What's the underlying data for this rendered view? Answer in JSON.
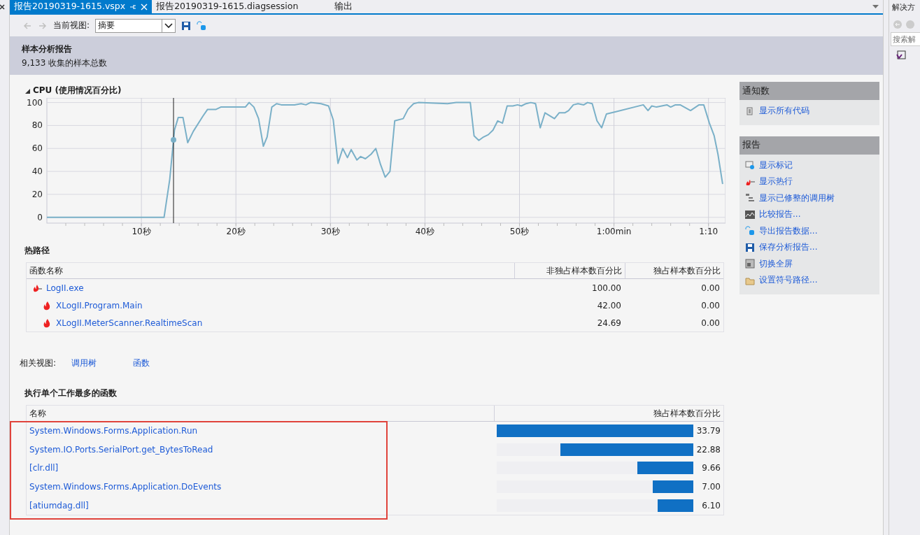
{
  "tabs": [
    {
      "label": "报告20190319-1615.vspx",
      "selected": true,
      "pinned": true
    },
    {
      "label": "报告20190319-1615.diagsession",
      "selected": false,
      "pinned": false
    },
    {
      "label": "输出",
      "selected": false,
      "pinned": false
    }
  ],
  "toolbar": {
    "back_disabled": true,
    "forward_disabled": true,
    "view_label": "当前视图:",
    "view_value": "摘要"
  },
  "report_header": {
    "title": "样本分析报告",
    "subtitle": "9,133 收集的样本总数"
  },
  "cpu_panel": {
    "title": "CPU (使用情况百分比)",
    "expanded": true,
    "chart_data": {
      "type": "line",
      "xlim": [
        0,
        71.8
      ],
      "ylim": [
        -5,
        104
      ],
      "xticks": [
        {
          "value": 10,
          "label": "10秒"
        },
        {
          "value": 20,
          "label": "20秒"
        },
        {
          "value": 30,
          "label": "30秒"
        },
        {
          "value": 40,
          "label": "40秒"
        },
        {
          "value": 50,
          "label": "50秒"
        },
        {
          "value": 60,
          "label": "1:00min"
        },
        {
          "value": 70,
          "label": "1:10"
        }
      ],
      "yticks": [
        0,
        20,
        40,
        60,
        80,
        100
      ],
      "x": [
        0,
        12.4,
        13.0,
        13.5,
        13.9,
        14.4,
        14.9,
        15.5,
        16.5,
        17.0,
        17.9,
        18.4,
        21.0,
        21.4,
        21.9,
        22.4,
        22.9,
        23.3,
        23.8,
        24.3,
        24.8,
        26.2,
        26.9,
        27.4,
        27.9,
        29.0,
        29.8,
        30.3,
        30.8,
        31.3,
        31.8,
        32.2,
        32.8,
        33.2,
        33.7,
        34.3,
        34.8,
        35.3,
        35.8,
        36.3,
        36.8,
        37.7,
        38.2,
        38.8,
        39.3,
        42.4,
        43.3,
        44.8,
        45.2,
        45.7,
        46.2,
        46.7,
        47.2,
        47.7,
        48.2,
        48.7,
        49.3,
        49.8,
        50.2,
        50.7,
        51.2,
        51.7,
        52.2,
        52.7,
        53.7,
        54.2,
        54.8,
        55.2,
        55.7,
        56.2,
        56.8,
        57.2,
        57.7,
        58.2,
        58.7,
        59.2,
        60.2,
        63.1,
        63.6,
        64.0,
        64.5,
        65.6,
        66.0,
        66.5,
        67.0,
        68.1,
        69.0,
        69.5,
        70.1,
        70.6,
        71.0,
        71.5
      ],
      "series": [
        {
          "color": "#7ab0c8",
          "values": [
            0,
            0,
            33,
            76,
            87,
            87,
            65,
            75,
            88,
            94,
            94,
            96,
            96,
            100,
            96,
            86,
            62,
            70,
            96,
            99,
            98,
            98,
            99,
            98,
            100,
            99,
            97,
            85,
            47,
            60,
            52,
            59,
            50,
            53,
            51,
            55,
            60,
            46,
            35,
            40,
            84,
            86,
            94,
            99,
            100,
            99,
            100,
            100,
            71,
            67,
            70,
            72,
            76,
            84,
            82,
            97,
            97,
            98,
            97,
            99,
            100,
            99,
            78,
            91,
            86,
            91,
            91,
            93,
            98,
            99,
            98,
            100,
            99,
            84,
            78,
            90,
            92,
            98,
            93,
            97,
            96,
            98,
            96,
            98,
            98,
            93,
            98,
            98,
            82,
            71,
            55,
            29
          ]
        }
      ],
      "grid": true,
      "ref_lines": [
        {
          "axis": "x",
          "value": 13.4
        }
      ]
    }
  },
  "hot_path": {
    "title": "热路径",
    "columns": [
      "函数名称",
      "非独占样本数百分比",
      "独占样本数百分比"
    ],
    "rows": [
      {
        "name": "LogII.exe",
        "inclusive": "100.00",
        "exclusive": "0.00",
        "children": [
          {
            "name": "XLogII.Program.Main",
            "inclusive": "42.00",
            "exclusive": "0.00"
          },
          {
            "name": "XLogII.MeterScanner.RealtimeScan",
            "inclusive": "24.69",
            "exclusive": "0.00"
          }
        ]
      }
    ]
  },
  "related_views": {
    "label": "相关视图:",
    "links": [
      "调用树",
      "函数"
    ]
  },
  "top_functions": {
    "title": "执行单个工作最多的函数",
    "columns": [
      "名称",
      "独占样本数百分比"
    ],
    "highlighted": true,
    "rows": [
      {
        "name": "System.Windows.Forms.Application.Run",
        "level": 1.0,
        "value": "33.79"
      },
      {
        "name": "System.IO.Ports.SerialPort.get_BytesToRead",
        "level": 0.677,
        "value": "22.88"
      },
      {
        "name": "[clr.dll]",
        "level": 0.286,
        "value": "9.66"
      },
      {
        "name": "System.Windows.Forms.Application.DoEvents",
        "level": 0.207,
        "value": "7.00"
      },
      {
        "name": "[atiumdag.dll]",
        "level": 0.18,
        "value": "6.10"
      }
    ]
  },
  "side_panels": [
    {
      "title": "通知数",
      "items": [
        "显示所有代码"
      ]
    },
    {
      "title": "报告",
      "items": [
        "显示标记",
        "显示热行",
        "显示已修整的调用树",
        "比较报告...",
        "导出报告数据...",
        "保存分析报告...",
        "切换全屏",
        "设置符号路径..."
      ]
    }
  ],
  "solution_explorer": {
    "title": "解决方",
    "search_placeholder": "搜索解"
  }
}
